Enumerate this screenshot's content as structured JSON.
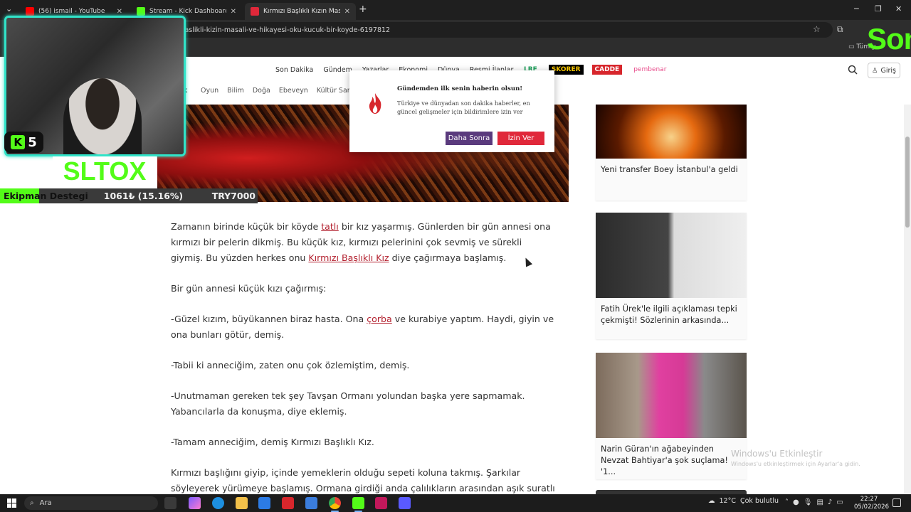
{
  "browser": {
    "tabs": [
      {
        "title": "(56) ismail - YouTube",
        "color": "#ff0000"
      },
      {
        "title": "Stream - Kick Dashboard",
        "color": "#53fc18"
      },
      {
        "title": "Kırmızı Başlıklı Kızın Masalı ve H",
        "color": "#e0283a"
      }
    ],
    "url": "-baslikli-kizin-masali-ve-hikayesi-oku-kucuk-bir-koyde-6197812",
    "bookmark": "Tüm y"
  },
  "site": {
    "nav": [
      "Son Dakika",
      "Gündem",
      "Yazarlar",
      "Ekonomi",
      "Dünya",
      "Resmi İlanlar"
    ],
    "brands": {
      "lrf": "LRF",
      "skorer": "SKORER",
      "cadde": "CADDE",
      "pembe": "pembenar"
    },
    "login": "Giriş",
    "subnav_cut": "uk",
    "subnav": [
      "Oyun",
      "Bilim",
      "Doğa",
      "Ebeveyn",
      "Kültür Sanat"
    ]
  },
  "popup": {
    "title": "Gündemden ilk senin haberin olsun!",
    "body": "Türkiye ve dünyadan son dakika haberler, en güncel gelişmeler için bildirimlere izin ver",
    "later": "Daha Sonra",
    "allow": "İzin Ver",
    "accent": "#e0283a"
  },
  "article": {
    "p1_a": "Zamanın birinde küçük bir köyde ",
    "p1_link1": "tatlı",
    "p1_b": " bir kız yaşarmış. Günlerden bir gün annesi ona kırmızı bir pelerin dikmiş. Bu küçük kız, kırmızı pelerinini çok sevmiş ve sürekli giymiş. Bu yüzden herkes onu ",
    "p1_link2": "Kırmızı Başlıklı Kız",
    "p1_c": " diye çağırmaya başlamış.",
    "p2": "Bir gün annesi küçük kızı çağırmış:",
    "p3_a": "-Güzel kızım, büyükannen biraz hasta. Ona ",
    "p3_link": "çorba",
    "p3_b": " ve kurabiye yaptım. Haydi, giyin ve ona bunları götür, demiş.",
    "p4": "-Tabii ki anneciğim, zaten onu çok özlemiştim, demiş.",
    "p5": "-Unutmaman gereken tek şey Tavşan Ormanı yolundan başka yere sapmamak. Yabancılarla da konuşma, diye eklemiş.",
    "p6": "-Tamam anneciğim, demiş Kırmızı Başlıklı Kız.",
    "p7": "Kırmızı başlığını giyip, içinde yemeklerin olduğu sepeti koluna takmış. Şarkılar söyleyerek yürümeye başlamış. Ormana girdiği anda çalılıkların arasından aşık suratlı"
  },
  "sidebar": [
    {
      "caption": "Yeni transfer Boey İstanbul'a geldi"
    },
    {
      "caption": "Fatih Ürek'le ilgili açıklaması tepki çekmişti! Sözlerinin arkasında..."
    },
    {
      "caption": "Narin Güran'ın ağabeyinden Nevzat Bahtiyar'a şok suçlama! '1..."
    }
  ],
  "stream": {
    "follower_count": "5",
    "name": "SLTOX",
    "goal_label": "Ekipman Destegi",
    "goal_amount": "1061₺",
    "goal_pct": "(15.16%)",
    "goal_progress": 0.1516,
    "goal_target": "TRY7000",
    "corner_text": "Son",
    "accent": "#53fc18"
  },
  "watermark": {
    "line1": "Windows'u Etkinleştir",
    "line2": "Windows'u etkinleştirmek için Ayarlar'a gidin."
  },
  "taskbar": {
    "search": "Ara",
    "weather": "12°C",
    "weather_desc": "Çok bulutlu",
    "time": "22:27",
    "date": "05/02/2026"
  }
}
